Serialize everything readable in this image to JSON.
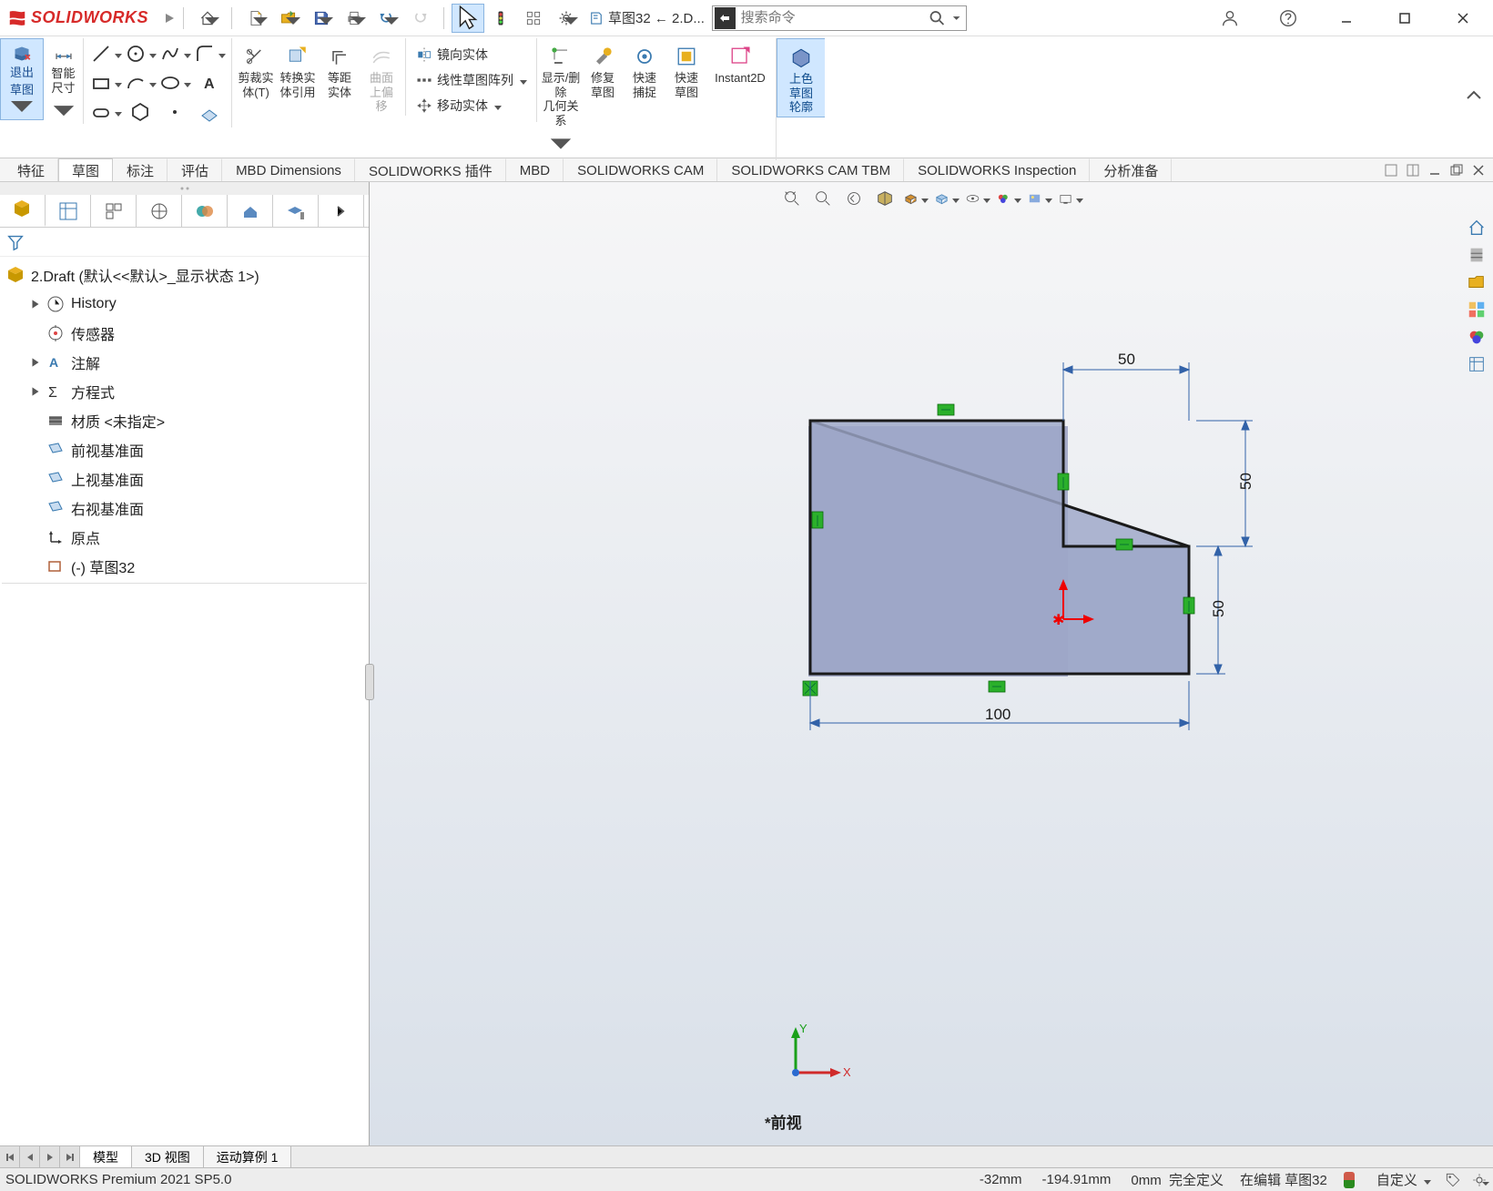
{
  "titlebar": {
    "logo_text": "SOLIDWORKS",
    "doc_label": "草图32 ← 2.D...",
    "search_placeholder": "搜索命令"
  },
  "ribbon": {
    "exit_sketch": "退出\n草图",
    "smart_dim": "智能\n尺寸",
    "trim": "剪裁实\n体(T)",
    "convert": "转换实\n体引用",
    "offset": "等距\n实体",
    "surface_offset": "曲面\n上偏\n移",
    "mirror": "镜向实体",
    "linear_pattern": "线性草图阵列",
    "move": "移动实体",
    "display_del": "显示/删除\n几何关系",
    "repair": "修复\n草图",
    "quick_snap": "快速\n捕捉",
    "quick_sketch": "快速\n草图",
    "instant2d": "Instant2D",
    "shaded": "上色\n草图\n轮廓"
  },
  "cmdtabs": {
    "t1": "特征",
    "t2": "草图",
    "t3": "标注",
    "t4": "评估",
    "t5": "MBD Dimensions",
    "t6": "SOLIDWORKS 插件",
    "t7": "MBD",
    "t8": "SOLIDWORKS CAM",
    "t9": "SOLIDWORKS CAM TBM",
    "t10": "SOLIDWORKS Inspection",
    "t11": "分析准备"
  },
  "tree": {
    "root": "2.Draft  (默认<<默认>_显示状态 1>)",
    "history": "History",
    "sensors": "传感器",
    "annotations": "注解",
    "equations": "方程式",
    "material": "材质 <未指定>",
    "front": "前视基准面",
    "top": "上视基准面",
    "right": "右视基准面",
    "origin": "原点",
    "sketch": "(-) 草图32"
  },
  "canvas": {
    "dim_50_top": "50",
    "dim_50_right_upper": "50",
    "dim_50_right_lower": "50",
    "dim_100_bottom": "100",
    "view_label": "*前视"
  },
  "bottom_tabs": {
    "model": "模型",
    "view3d": "3D 视图",
    "motion": "运动算例 1"
  },
  "statusbar": {
    "product": "SOLIDWORKS Premium 2021 SP5.0",
    "coord_x": "-32mm",
    "coord_y": "-194.91mm",
    "coord_z": "0mm",
    "fully_defined": "完全定义",
    "editing": "在编辑 草图32",
    "custom": "自定义"
  },
  "chart_data": {
    "type": "diagram",
    "shape": "L-shape sketch",
    "outer_width": 100,
    "outer_height": 100,
    "cutout_width": 50,
    "cutout_height": 50,
    "cutout_position": "top-right (but shaded region is L, cutout shown at top-right with dimension 50 top)",
    "dimensions_shown": [
      {
        "label": "50",
        "location": "top horizontal cutout width"
      },
      {
        "label": "50",
        "location": "right vertical upper segment height"
      },
      {
        "label": "50",
        "location": "right vertical lower segment height"
      },
      {
        "label": "100",
        "location": "bottom horizontal full width"
      }
    ],
    "units": "mm",
    "relations": [
      "horizontal",
      "vertical",
      "coincident-origin"
    ]
  }
}
